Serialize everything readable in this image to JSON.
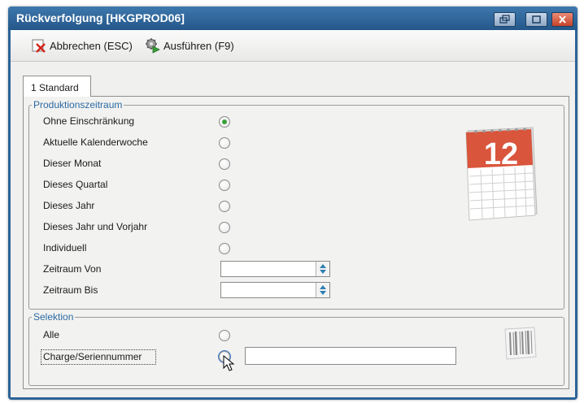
{
  "window": {
    "title": "Rückverfolgung [HKGPROD06]",
    "controls": [
      "restore-icon",
      "maximize-icon",
      "close-icon"
    ]
  },
  "toolbar": {
    "cancel_label": "Abbrechen (ESC)",
    "execute_label": "Ausführen (F9)",
    "cancel_icon": "red-x-icon",
    "execute_icon": "run-gear-icon"
  },
  "tabs": [
    {
      "label": "1 Standard",
      "active": true
    }
  ],
  "produktionszeitraum": {
    "legend": "Produktionszeitraum",
    "options": [
      {
        "label": "Ohne Einschränkung",
        "checked": true
      },
      {
        "label": "Aktuelle Kalenderwoche",
        "checked": false
      },
      {
        "label": "Dieser Monat",
        "checked": false
      },
      {
        "label": "Dieses Quartal",
        "checked": false
      },
      {
        "label": "Dieses Jahr",
        "checked": false
      },
      {
        "label": "Dieses Jahr und Vorjahr",
        "checked": false
      },
      {
        "label": "Individuell",
        "checked": false
      }
    ],
    "von_label": "Zeitraum Von",
    "von_value": "",
    "bis_label": "Zeitraum Bis",
    "bis_value": "",
    "calendar_icon": "calendar-icon",
    "calendar_number": "12"
  },
  "selektion": {
    "legend": "Selektion",
    "alle_label": "Alle",
    "alle_checked": false,
    "charge_label": "Charge/Seriennummer",
    "charge_checked": false,
    "charge_value": "",
    "barcode_icon": "barcode-icon"
  },
  "colors": {
    "titlebar": "#2c6396",
    "legend": "#2c6aa3",
    "radio_checked": "#3aa03a",
    "calendar_red": "#d9553c"
  }
}
